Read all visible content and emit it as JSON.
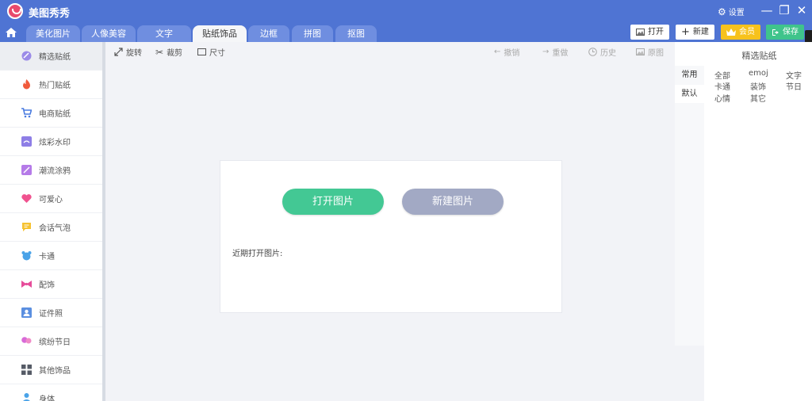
{
  "app": {
    "title": "美图秀秀"
  },
  "titlebar": {
    "settings_label": "设置",
    "minimize": "—",
    "restore": "❐",
    "close": "✕"
  },
  "tabs": [
    {
      "label": "美化图片"
    },
    {
      "label": "人像美容"
    },
    {
      "label": "文字"
    },
    {
      "label": "贴纸饰品"
    },
    {
      "label": "边框"
    },
    {
      "label": "拼图"
    },
    {
      "label": "抠图"
    }
  ],
  "top_buttons": {
    "open": "打开",
    "new": "新建",
    "vip": "会员",
    "save": "保存"
  },
  "sidebar": {
    "items": [
      {
        "label": "精选贴纸",
        "color": "#9b8be8"
      },
      {
        "label": "热门贴纸",
        "color": "#f05a3c"
      },
      {
        "label": "电商贴纸",
        "color": "#4a7be0"
      },
      {
        "label": "炫彩水印",
        "color": "#8e7ee6"
      },
      {
        "label": "潮流涂鸦",
        "color": "#b57be8"
      },
      {
        "label": "可爱心",
        "color": "#f0528f"
      },
      {
        "label": "会话气泡",
        "color": "#f6c230"
      },
      {
        "label": "卡通",
        "color": "#4aa3e8"
      },
      {
        "label": "配饰",
        "color": "#e64c9a"
      },
      {
        "label": "证件照",
        "color": "#5b8fe0"
      },
      {
        "label": "缤纷节日",
        "color": "#d86ad8"
      },
      {
        "label": "其他饰品",
        "color": "#555b66"
      },
      {
        "label": "身体",
        "color": "#4aa3e8"
      }
    ]
  },
  "toolbar": {
    "rotate": "旋转",
    "crop": "裁剪",
    "size": "尺寸",
    "undo": "撤销",
    "redo": "重做",
    "history": "历史",
    "original": "原图"
  },
  "start_card": {
    "open_button": "打开图片",
    "new_button": "新建图片",
    "recent_label": "近期打开图片:"
  },
  "right_panel": {
    "title": "精选贴纸",
    "tabs": [
      "常用",
      "默认"
    ],
    "categories": [
      "全部",
      "emoj",
      "文字",
      "卡通",
      "装饰",
      "节日",
      "心情",
      "其它"
    ]
  },
  "colors": {
    "accent": "#4f74d3",
    "green": "#43c894",
    "gray_button": "#a2a9c4",
    "vip": "#f7c21c",
    "save": "#3fc48b"
  }
}
